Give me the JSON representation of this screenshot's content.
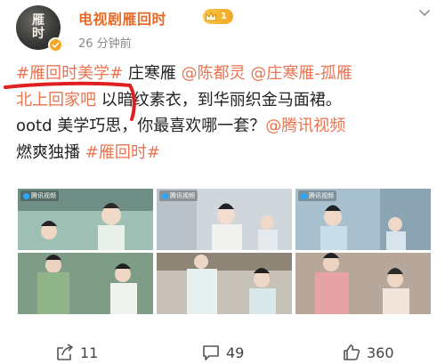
{
  "post": {
    "author": "电视剧雁回时",
    "vip_level": "1",
    "time": "26 分钟前",
    "content": {
      "line1": [
        {
          "t": "#雁回时美学#",
          "k": "link"
        },
        {
          "t": " 庄寒雁 ",
          "k": "plain"
        },
        {
          "t": "@陈都灵",
          "k": "link"
        },
        {
          "t": " ",
          "k": "plain"
        },
        {
          "t": "@庄寒雁-孤雁",
          "k": "link"
        }
      ],
      "line2": [
        {
          "t": "北上回家吧",
          "k": "link"
        },
        {
          "t": " 以暗纹素衣，到华丽织金马面裙。",
          "k": "plain"
        }
      ],
      "line3": [
        {
          "t": "ootd 美学巧思，你最喜欢哪一套？",
          "k": "plain"
        },
        {
          "t": "@腾讯视频",
          "k": "link"
        }
      ],
      "line4": [
        {
          "t": "燃爽独播 ",
          "k": "plain"
        },
        {
          "t": "#雁回时#",
          "k": "link"
        }
      ]
    },
    "watermark": "腾讯视频",
    "images": [
      {
        "name": "still-1"
      },
      {
        "name": "still-2"
      },
      {
        "name": "still-3"
      },
      {
        "name": "still-4"
      },
      {
        "name": "still-5"
      },
      {
        "name": "still-6"
      }
    ]
  },
  "actions": {
    "share": "11",
    "comment": "49",
    "like": "360"
  },
  "colors": {
    "author": "#e86a26",
    "link": "#eb7350",
    "annotation": "#e02020"
  },
  "icons": {
    "verified": "verified-badge-icon",
    "vip": "crown-icon",
    "menu": "chevron-down-icon",
    "share": "share-icon",
    "comment": "comment-icon",
    "like": "thumbs-up-icon"
  }
}
